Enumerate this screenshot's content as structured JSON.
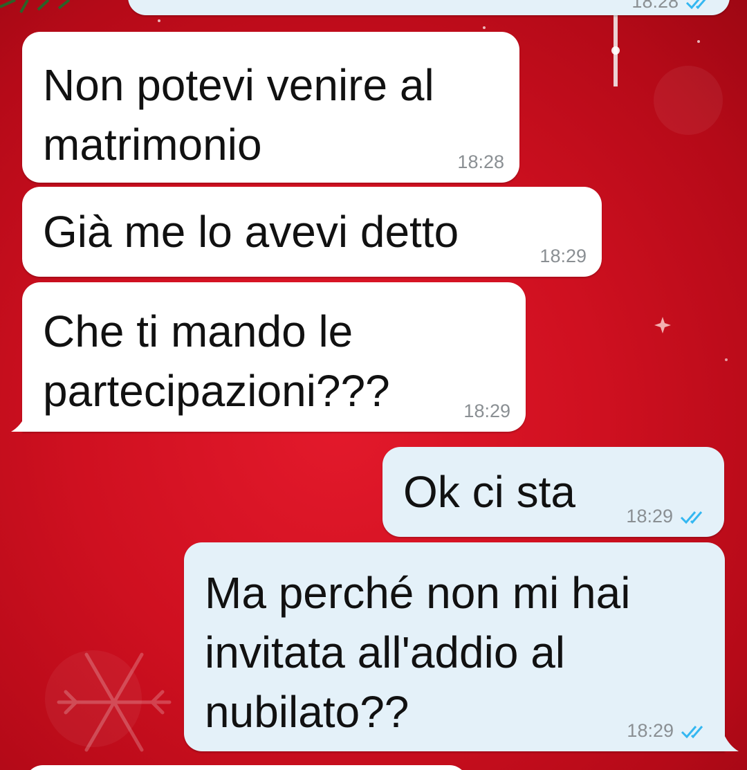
{
  "colors": {
    "background": "#cf1020",
    "incoming_bubble": "#ffffff",
    "outgoing_bubble": "#e4f1f9",
    "read_ticks": "#34b7f1"
  },
  "top_partial": {
    "time": "18:28"
  },
  "messages": [
    {
      "direction": "incoming",
      "text": "Non potevi venire al\nmatrimonio",
      "time": "18:28"
    },
    {
      "direction": "incoming",
      "text": "Già me lo avevi detto",
      "time": "18:29"
    },
    {
      "direction": "incoming",
      "text": "Che ti mando le\npartecipazioni???",
      "time": "18:29"
    },
    {
      "direction": "outgoing",
      "text": "Ok ci sta",
      "time": "18:29",
      "status_icon": "double-check-read-icon"
    },
    {
      "direction": "outgoing",
      "text": "Ma perché non mi hai\ninvitata all'addio al\nnubilato??",
      "time": "18:29",
      "status_icon": "double-check-read-icon"
    }
  ]
}
